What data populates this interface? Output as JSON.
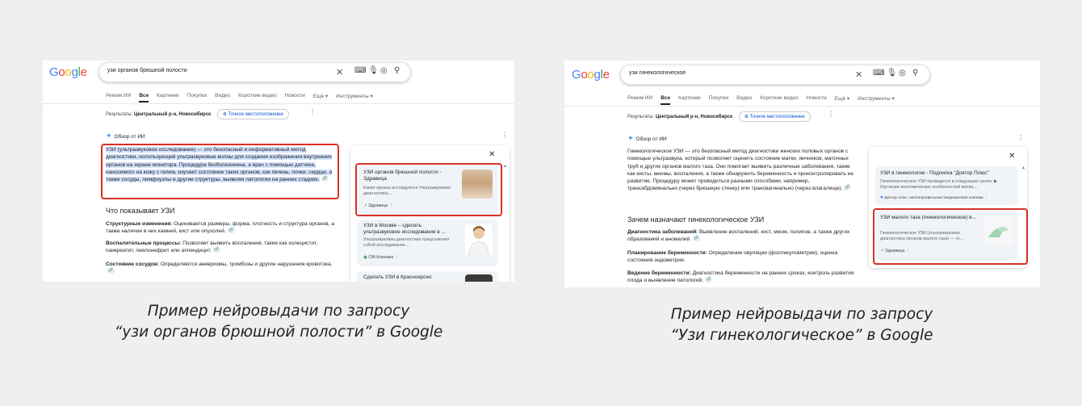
{
  "logo_letters": [
    {
      "ch": "G",
      "color": "#4285f4"
    },
    {
      "ch": "o",
      "color": "#ea4335"
    },
    {
      "ch": "o",
      "color": "#fbbc05"
    },
    {
      "ch": "g",
      "color": "#4285f4"
    },
    {
      "ch": "l",
      "color": "#34a853"
    },
    {
      "ch": "e",
      "color": "#ea4335"
    }
  ],
  "common": {
    "tabs": [
      "Режим ИИ",
      "Все",
      "Картинки",
      "Покупки",
      "Видео",
      "Короткие видео",
      "Новости",
      "Ещё ▾",
      "Инструменты ▾"
    ],
    "results_prefix": "Результаты:",
    "results_location": "Центральный р-н, Новосибирск",
    "precise_location": "Точное местоположение",
    "ai_overview": "Обзор от ИИ"
  },
  "shot1": {
    "query": "узи органов брюшной полости",
    "intro_highlighted": "УЗИ (ультразвуковое исследование) — это безопасный и информативный метод диагностики, использующий ультразвуковые волны для создания изображения внутренних органов на экране монитора.",
    "intro_rest": " Процедура безболезненна, а врач с помощью датчика, наносимого на кожу с гелем, изучает состояние таких органов, как печень, почки, сердце, а также сосуды, лимфоузлы и другие структуры, выявляя патологии на ранних стадиях.",
    "section_title": "Что показывает УЗИ",
    "items": [
      {
        "label": "Структурные изменения:",
        "text": " Оценивается размеры, форма, плотность и структура органов, а также наличие в них камней, кист или опухолей."
      },
      {
        "label": "Воспалительные процессы:",
        "text": " Позволяет выявить воспаления, такие как холецистит, панкреатит, пиелонефрит или аппендицит."
      },
      {
        "label": "Состояние сосудов:",
        "text": " Определяются аневризмы, тромбозы и другие нарушения кровотока."
      }
    ],
    "cards": [
      {
        "title": "УЗИ органов брюшной полости - Здравица",
        "snippet": "Какие органы исследуются Ультразвуковая диагностика ...",
        "source": "Здравица"
      },
      {
        "title": "УЗИ в Москве – сделать ультразвуковое исследование в ...",
        "snippet": "Ультразвуковая диагностика представляет собой исследование...",
        "source": "СМ-Клиника"
      },
      {
        "title": "Сделать УЗИ в Красноярске:",
        "snippet": "",
        "source": ""
      }
    ],
    "caption": [
      "Пример нейровыдачи по запросу",
      "“узи органов брюшной полости” в Google"
    ]
  },
  "shot2": {
    "query": "узи гинекологическое",
    "intro": "Гинекологическое УЗИ — это безопасный метод диагностики женских половых органов с помощью ультразвука, который позволяет оценить состояние матки, яичников, маточных труб и других органов малого таза. Оно помогает выявить различные заболевания, такие как кисты, миомы, воспаления, а также обнаружить беременность и проконтролировать ее развитие. Процедуру может проводиться разными способами, например, трансабдоминально (через брюшную стенку) или трансвагинально (через влагалище).",
    "section_title": "Зачем назначают гинекологическое УЗИ",
    "items": [
      {
        "label": "Диагностика заболеваний:",
        "text": " Выявление воспалений, кист, миом, полипов, а также других образований и аномалий."
      },
      {
        "label": "Планирование беременности:",
        "text": " Определение овуляции (фолликулометрия), оценка состояния эндометрия."
      },
      {
        "label": "Ведение беременности:",
        "text": " Диагностика беременности на ранних сроках, контроль развития плода и выявление патологий."
      }
    ],
    "cards": [
      {
        "title": "УЗИ в гинекологии - Подписка \"Доктор Плюс\"",
        "snippet": "Гинекологическое УЗИ проводится в следующих целях: ▶ Изучение анатомических особенностей матки,...",
        "source": "Доктор плюс, многопрофильные медицинские клиники"
      },
      {
        "title": "УЗИ малого таза (гинекологическое) в...",
        "snippet": "Гинекологическое УЗИ (ультразвуковая диагностика органов малого таза) — эт...",
        "source": "Здравица"
      }
    ],
    "caption": [
      "Пример нейровыдачи по запросу",
      "“Узи гинекологическое” в Google"
    ]
  }
}
